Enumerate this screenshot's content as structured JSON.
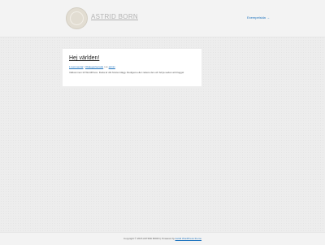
{
  "header": {
    "site_title": "ASTRID BORN",
    "nav_link": "Exempelsida →"
  },
  "post": {
    "title": "Hej världen!",
    "comments": "1 kommentar",
    "category": "Okategoriserade",
    "by": "av",
    "author": "admin",
    "excerpt": "Välkommen till WordPress. Detta är ditt första inlägg. Redigera eller radera det och börja sedan att blogga!"
  },
  "footer": {
    "copyright": "Copyright © 2015 ASTRID BORN",
    "powered_by": "Powered by",
    "theme_link": "Astrid WordPress theme"
  }
}
